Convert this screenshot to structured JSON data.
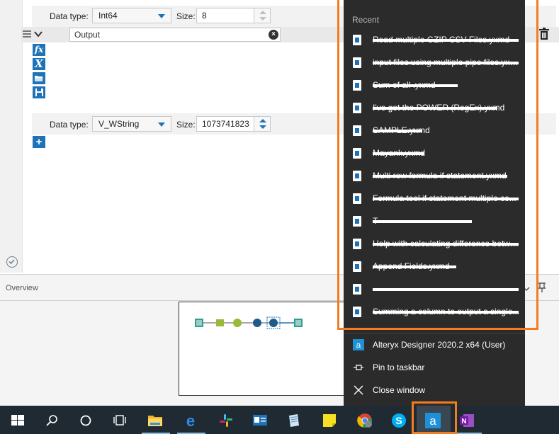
{
  "editor": {
    "row1": {
      "datatype_label": "Data type:",
      "datatype_value": "Int64",
      "size_label": "Size:",
      "size_value": "8"
    },
    "output_field": {
      "value": "Output"
    },
    "row2": {
      "datatype_label": "Data type:",
      "datatype_value": "V_WString",
      "size_label": "Size:",
      "size_value": "1073741823"
    },
    "tool_buttons": [
      "fx",
      "X",
      "open",
      "save"
    ],
    "add_button": "+"
  },
  "overview": {
    "title": "Overview"
  },
  "jumplist": {
    "section_title": "Recent",
    "recent_items": [
      {
        "label": "Read multiple GZIP CSV Files.yxmd",
        "redacted": false
      },
      {
        "label": "input files using multiple pipe files.yxmd",
        "redacted": false
      },
      {
        "label": "Sum of all .yxmd",
        "redacted": false
      },
      {
        "label": "I've got the POWER (RegEx).yxmd",
        "redacted": false
      },
      {
        "label": "SAMPLE.yxmd",
        "redacted": false
      },
      {
        "label": "Mayank.yxmd",
        "redacted": false
      },
      {
        "label": "Multi row formula if statement.yxmd",
        "redacted": false
      },
      {
        "label": "Formula tool if statement multiple co...",
        "redacted": false
      },
      {
        "label": "T",
        "redacted": true
      },
      {
        "label": "Help with calculating difference betwe...",
        "redacted": false
      },
      {
        "label": "Append Fields.yxmd",
        "redacted": false
      },
      {
        "label": "",
        "redacted": true
      },
      {
        "label": "Summing a column to output a single...",
        "redacted": false
      }
    ],
    "actions": {
      "app": "Alteryx Designer 2020.2 x64 (User)",
      "pin": "Pin to taskbar",
      "close": "Close window"
    }
  },
  "taskbar": {
    "icons": [
      "windows-start",
      "search",
      "cortana",
      "task-view",
      "file-explorer",
      "edge",
      "slack",
      "outlook-contact",
      "notepad",
      "sticky-notes",
      "chrome",
      "skype",
      "alteryx",
      "onenote"
    ]
  },
  "colors": {
    "accent": "#1e73b8",
    "highlight": "#f47c20",
    "jumplist_bg": "#2b2b2b",
    "taskbar_bg": "#1f2a33"
  }
}
